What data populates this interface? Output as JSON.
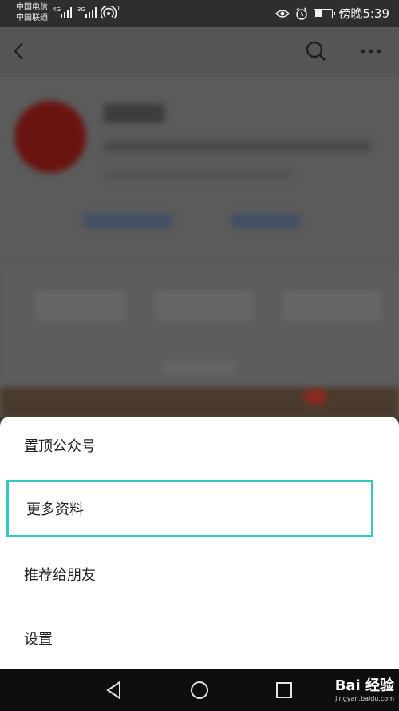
{
  "status_bar": {
    "carrier1": "中国电信",
    "carrier2": "中国联通",
    "net1": "4G",
    "net2": "3G",
    "wifi_badge": "1",
    "time": "傍晚5:39"
  },
  "sheet": {
    "items": [
      {
        "label": "置顶公众号"
      },
      {
        "label": "更多资料"
      },
      {
        "label": "推荐给朋友"
      },
      {
        "label": "设置"
      }
    ]
  },
  "watermark": {
    "text": "Bai 经验",
    "url": "jingyan.baidu.com"
  },
  "colors": {
    "highlight": "#34c7c4",
    "overlay": "#5b5b5b",
    "navbar": "#0e0e0e"
  }
}
